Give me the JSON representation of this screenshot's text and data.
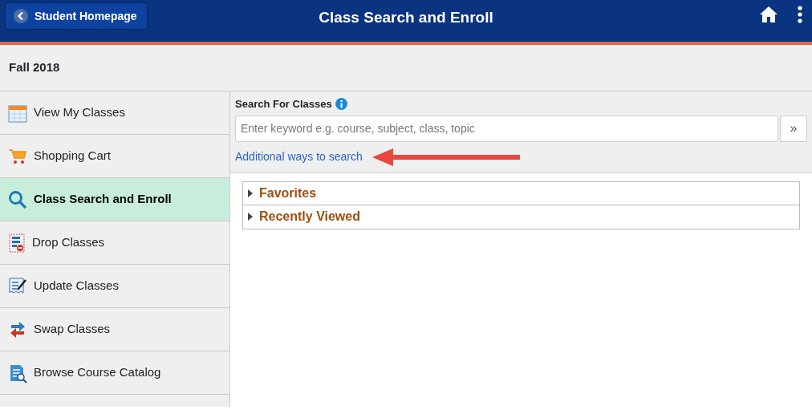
{
  "header": {
    "back_button": "Student Homepage",
    "title": "Class Search and Enroll"
  },
  "term": "Fall 2018",
  "sidebar": {
    "items": [
      {
        "label": "View My Classes",
        "selected": false
      },
      {
        "label": "Shopping Cart",
        "selected": false
      },
      {
        "label": "Class Search and Enroll",
        "selected": true
      },
      {
        "label": "Drop Classes",
        "selected": false
      },
      {
        "label": "Update Classes",
        "selected": false
      },
      {
        "label": "Swap Classes",
        "selected": false
      },
      {
        "label": "Browse Course Catalog",
        "selected": false
      }
    ]
  },
  "search": {
    "label": "Search For Classes",
    "placeholder": "Enter keyword e.g. course, subject, class, topic",
    "submit": "»",
    "link": "Additional ways to search"
  },
  "sections": [
    {
      "label": "Favorites",
      "expanded": false
    },
    {
      "label": "Recently Viewed",
      "expanded": false
    }
  ]
}
